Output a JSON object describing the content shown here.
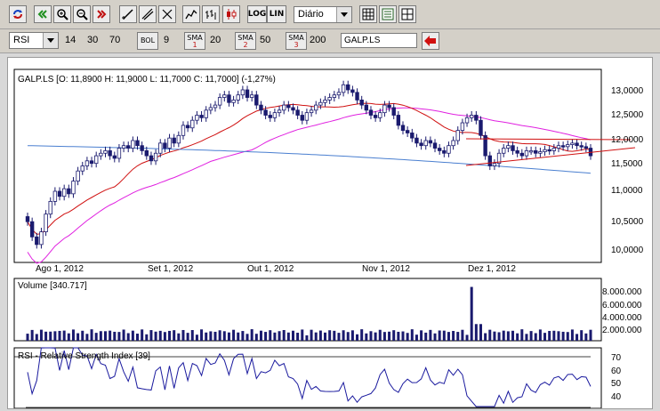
{
  "toolbar": {
    "period_select": "Diário",
    "log_label": "LOG",
    "lin_label": "LIN"
  },
  "indicator_bar": {
    "indicator_select": "RSI",
    "param1": "14",
    "param2": "30",
    "param3": "70",
    "bol_label": "BOL",
    "bol_value": "9",
    "sma1_label": "SMA",
    "sma1_index": "1",
    "sma1_value": "20",
    "sma2_label": "SMA",
    "sma2_index": "2",
    "sma2_value": "50",
    "sma3_label": "SMA",
    "sma3_index": "3",
    "sma3_value": "200",
    "symbol_input": "GALP.LS"
  },
  "price_panel": {
    "legend": "GALP.LS [O: 11,8900  H: 11,9000  L: 11,7000  C: 11,7000] (-1,27%)",
    "y_ticks": [
      "13,0000",
      "12,5000",
      "12,0000",
      "11,5000",
      "11,0000",
      "10,5000",
      "10,0000"
    ],
    "x_ticks": [
      "Ago 1, 2012",
      "Set 1, 2012",
      "Out 1, 2012",
      "Nov 1, 2012",
      "Dez 1, 2012"
    ]
  },
  "volume_panel": {
    "legend": "Volume [340.717]",
    "y_ticks": [
      "8.000.000",
      "6.000.000",
      "4.000.000",
      "2.000.000"
    ]
  },
  "rsi_panel": {
    "legend": "RSI - Relative Strength Index [39]",
    "y_ticks": [
      "70",
      "60",
      "50",
      "40"
    ]
  },
  "colors": {
    "candle": "#1a1a6e",
    "sma20": "#d01010",
    "sma50": "#e020e0",
    "sma200": "#4a7fd0",
    "rsi": "#1a1a9e",
    "trend": "#d01010"
  },
  "chart_data": {
    "type": "line",
    "series_close": [
      10.4,
      10.1,
      9.95,
      10.2,
      10.55,
      10.8,
      11.0,
      10.9,
      11.05,
      10.95,
      11.2,
      11.4,
      11.5,
      11.6,
      11.55,
      11.7,
      11.75,
      11.8,
      11.7,
      11.65,
      11.85,
      11.9,
      11.85,
      12.0,
      11.9,
      11.8,
      11.7,
      11.6,
      11.75,
      11.95,
      11.85,
      12.05,
      11.95,
      12.1,
      12.3,
      12.25,
      12.4,
      12.5,
      12.45,
      12.6,
      12.65,
      12.7,
      12.85,
      12.9,
      12.75,
      12.8,
      12.9,
      13.0,
      12.85,
      12.9,
      12.7,
      12.6,
      12.5,
      12.45,
      12.55,
      12.6,
      12.7,
      12.65,
      12.6,
      12.5,
      12.4,
      12.55,
      12.6,
      12.7,
      12.75,
      12.8,
      12.85,
      12.9,
      12.95,
      13.1,
      13.0,
      12.95,
      12.8,
      12.7,
      12.6,
      12.5,
      12.45,
      12.55,
      12.7,
      12.65,
      12.5,
      12.3,
      12.2,
      12.15,
      12.05,
      11.95,
      11.9,
      12.0,
      11.95,
      11.85,
      11.8,
      11.75,
      11.9,
      12.0,
      12.2,
      12.35,
      12.45,
      12.5,
      12.4,
      12.1,
      11.7,
      11.5,
      11.55,
      11.75,
      11.85,
      11.9,
      11.8,
      11.75,
      11.7,
      11.8,
      11.8,
      11.75,
      11.78,
      11.82,
      11.8,
      11.85,
      11.9,
      11.88,
      11.92,
      11.95,
      11.9,
      11.88,
      11.85,
      11.7
    ]
  }
}
